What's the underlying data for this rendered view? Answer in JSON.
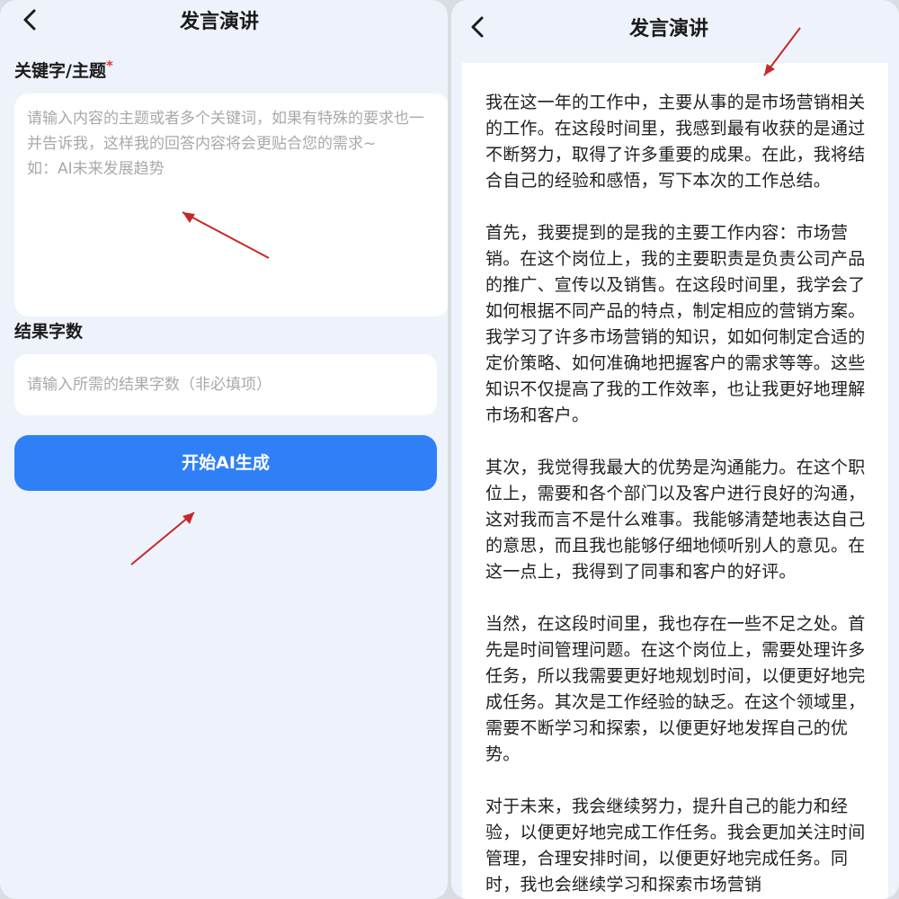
{
  "left_screen": {
    "title": "发言演讲",
    "keyword_label": "关键字/主题",
    "required_mark": "*",
    "keyword_placeholder": "请输入内容的主题或者多个关键词，如果有特殊的要求也一并告诉我，这样我的回答内容将会更贴合您的需求~",
    "keyword_example": "如：AI未来发展趋势",
    "word_count_label": "结果字数",
    "word_count_placeholder": "请输入所需的结果字数（非必填项）",
    "generate_button": "开始AI生成"
  },
  "right_screen": {
    "title": "发言演讲",
    "paragraphs": [
      "我在这一年的工作中，主要从事的是市场营销相关的工作。在这段时间里，我感到最有收获的是通过不断努力，取得了许多重要的成果。在此，我将结合自己的经验和感悟，写下本次的工作总结。",
      "首先，我要提到的是我的主要工作内容：市场营销。在这个岗位上，我的主要职责是负责公司产品的推广、宣传以及销售。在这段时间里，我学会了如何根据不同产品的特点，制定相应的营销方案。我学习了许多市场营销的知识，如如何制定合适的定价策略、如何准确地把握客户的需求等等。这些知识不仅提高了我的工作效率，也让我更好地理解市场和客户。",
      "其次，我觉得我最大的优势是沟通能力。在这个职位上，需要和各个部门以及客户进行良好的沟通，这对我而言不是什么难事。我能够清楚地表达自己的意思，而且我也能够仔细地倾听别人的意见。在这一点上，我得到了同事和客户的好评。",
      "当然，在这段时间里，我也存在一些不足之处。首先是时间管理问题。在这个岗位上，需要处理许多任务，所以我需要更好地规划时间，以便更好地完成任务。其次是工作经验的缺乏。在这个领域里，需要不断学习和探索，以便更好地发挥自己的优势。",
      "对于未来，我会继续努力，提升自己的能力和经验，以便更好地完成工作任务。我会更加关注时间管理，合理安排时间，以便更好地完成任务。同时，我也会继续学习和探索市场营销"
    ]
  },
  "colors": {
    "background": "#edf2fb",
    "accent": "#2f80f7",
    "required": "#e53935",
    "annotation_arrow": "#c62828"
  }
}
